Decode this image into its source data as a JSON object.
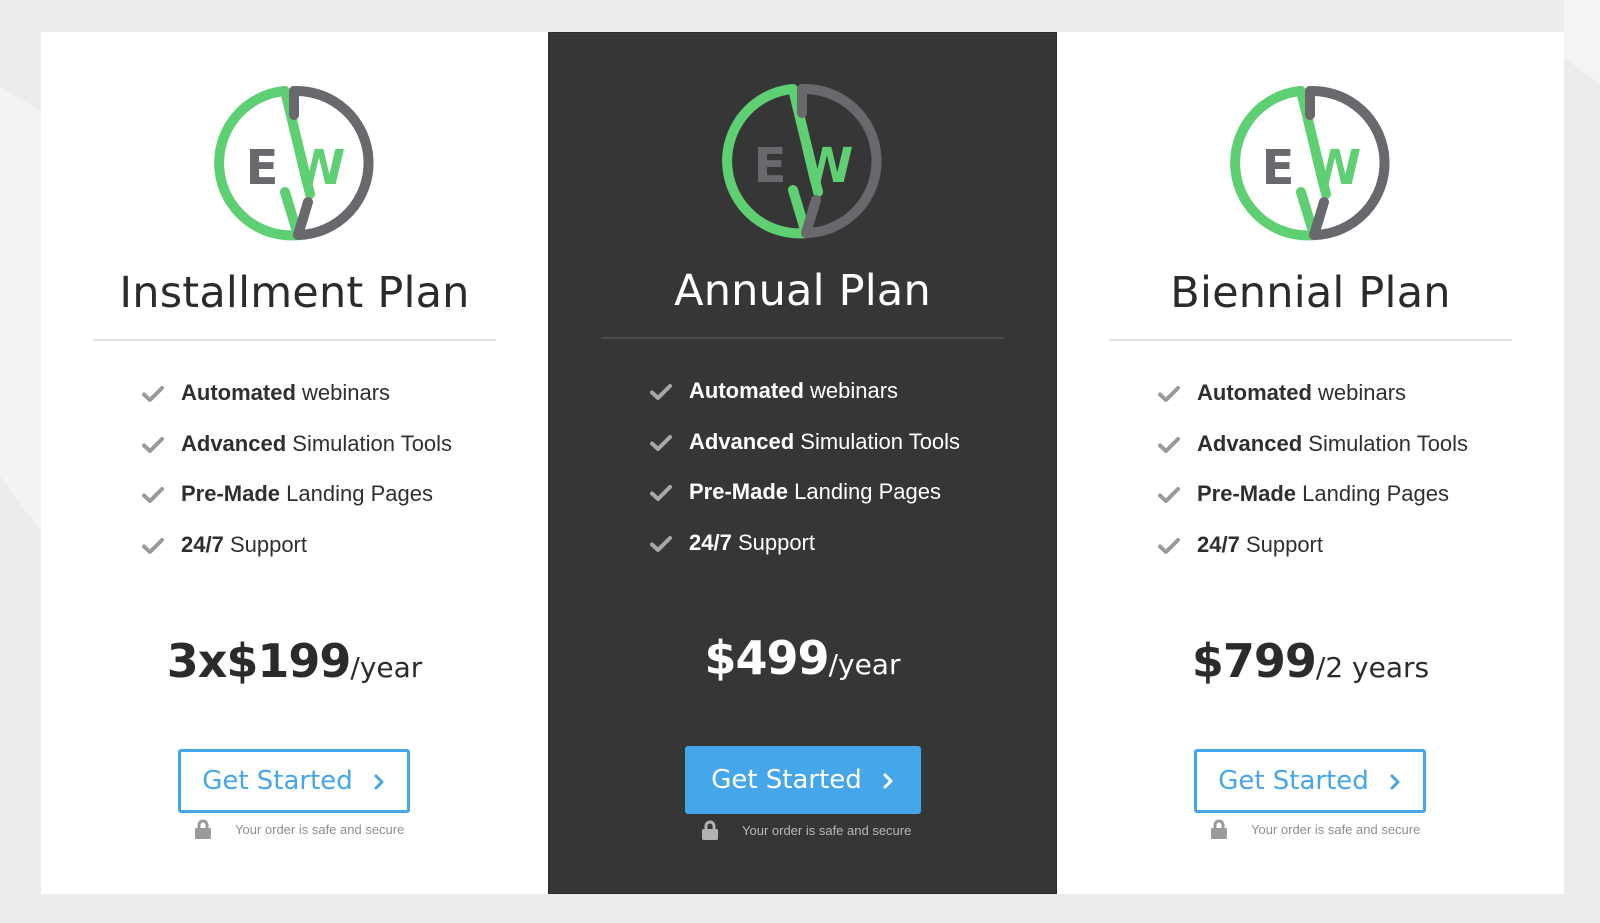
{
  "plans": [
    {
      "title": "Installment Plan",
      "features": [
        {
          "bold": "Automated",
          "text": " webinars"
        },
        {
          "bold": "Advanced",
          "text": " Simulation Tools"
        },
        {
          "bold": "Pre-Made",
          "text": " Landing Pages"
        },
        {
          "bold": "24/7",
          "text": " Support"
        }
      ],
      "price": {
        "amount": "3x$199",
        "period": "/year"
      },
      "cta": "Get Started",
      "secure_text": "Your order is safe and secure"
    },
    {
      "title": "Annual Plan",
      "features": [
        {
          "bold": "Automated",
          "text": " webinars"
        },
        {
          "bold": "Advanced",
          "text": " Simulation Tools"
        },
        {
          "bold": "Pre-Made",
          "text": " Landing Pages"
        },
        {
          "bold": "24/7",
          "text": " Support"
        }
      ],
      "price": {
        "amount": "$499",
        "period": "/year"
      },
      "cta": "Get Started",
      "secure_text": "Your order is safe and secure"
    },
    {
      "title": "Biennial Plan",
      "features": [
        {
          "bold": "Automated",
          "text": " webinars"
        },
        {
          "bold": "Advanced",
          "text": " Simulation Tools"
        },
        {
          "bold": "Pre-Made",
          "text": " Landing Pages"
        },
        {
          "bold": "24/7",
          "text": " Support"
        }
      ],
      "price": {
        "amount": "$799",
        "period": "/2 years"
      },
      "cta": "Get Started",
      "secure_text": "Your order is safe and secure"
    }
  ],
  "logo": {
    "letters": [
      "E",
      "W"
    ]
  },
  "colors": {
    "page_bg": "#ececec",
    "card_bg": "#ffffff",
    "featured_card_bg": "#363636",
    "accent_blue": "#45a6ea",
    "logo_green": "#5fcf73",
    "logo_gray": "#69686d",
    "title_dark": "#2b2b2b",
    "check_gray": "#9a9a9a"
  },
  "icons": {
    "feature_bullet": "check-icon",
    "cta": "chevron-right-icon",
    "secure": "lock-icon"
  }
}
